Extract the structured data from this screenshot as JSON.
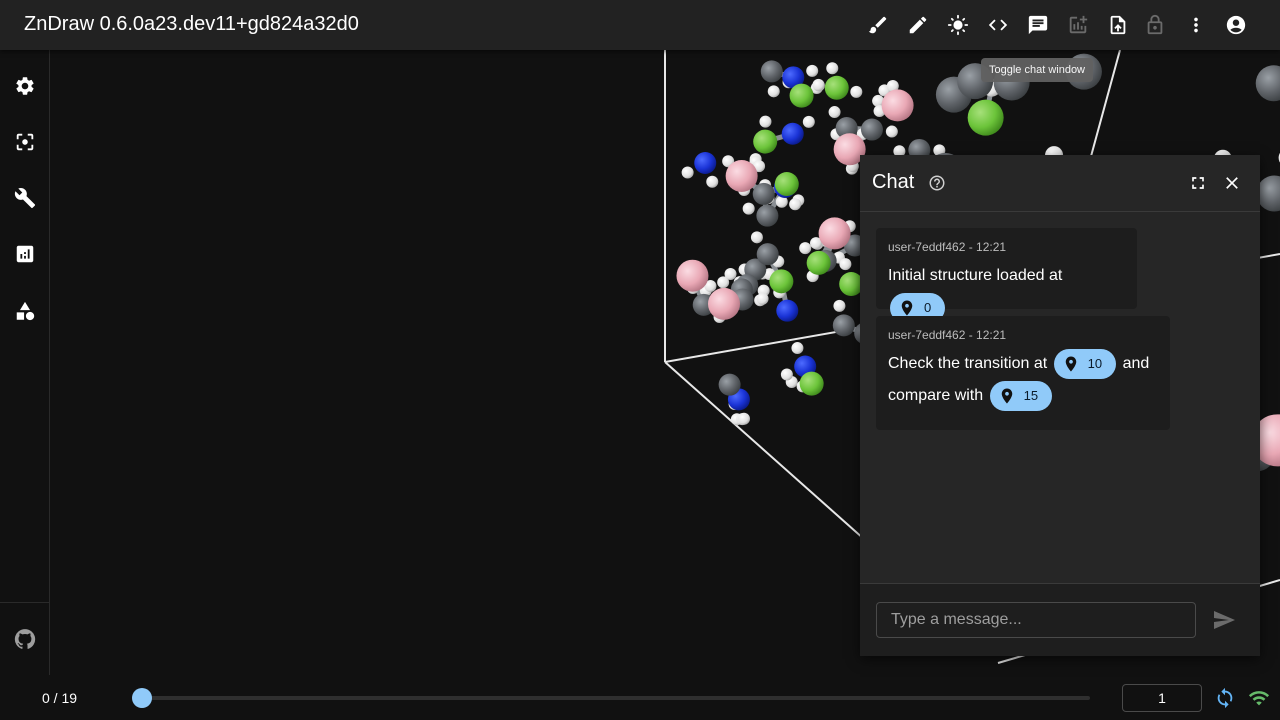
{
  "app": {
    "title": "ZnDraw 0.6.0a23.dev11+gd824a32d0"
  },
  "toolbar": {
    "icons": [
      "paintbrush-icon",
      "pencil-icon",
      "brightness-icon",
      "code-icon",
      "chat-icon",
      "add-chart-icon",
      "upload-file-icon",
      "lock-icon",
      "more-vert-icon",
      "account-icon"
    ],
    "tooltip": "Toggle chat window"
  },
  "sidebar": {
    "items": [
      "settings-icon",
      "center-focus-icon",
      "wrench-icon",
      "analytics-icon",
      "shapes-icon"
    ],
    "footer": "github-icon"
  },
  "viewport": {
    "atom_colors": {
      "carbon": "#5f6368",
      "hydrogen": "#e6e6e6",
      "nitrogen": "#1a33d6",
      "chlorine": "#6cc43a",
      "boron": "#e9a8b5"
    }
  },
  "chat": {
    "title": "Chat",
    "messages": [
      {
        "meta": "user-7eddf462 - 12:21",
        "text_before": "Initial structure loaded at",
        "chip": "0"
      },
      {
        "meta": "user-7eddf462 - 12:21",
        "text_before": "Check the transition at",
        "chip1": "10",
        "text_mid": "and",
        "text_line2": "compare with",
        "chip2": "15"
      }
    ],
    "input_placeholder": "Type a message..."
  },
  "player": {
    "frame_counter": "0 / 19",
    "progress": 0,
    "step": "1"
  },
  "colors": {
    "accent": "#90caf9",
    "connected": "#66bb6a",
    "background": "#111111",
    "topbar": "#222222"
  }
}
